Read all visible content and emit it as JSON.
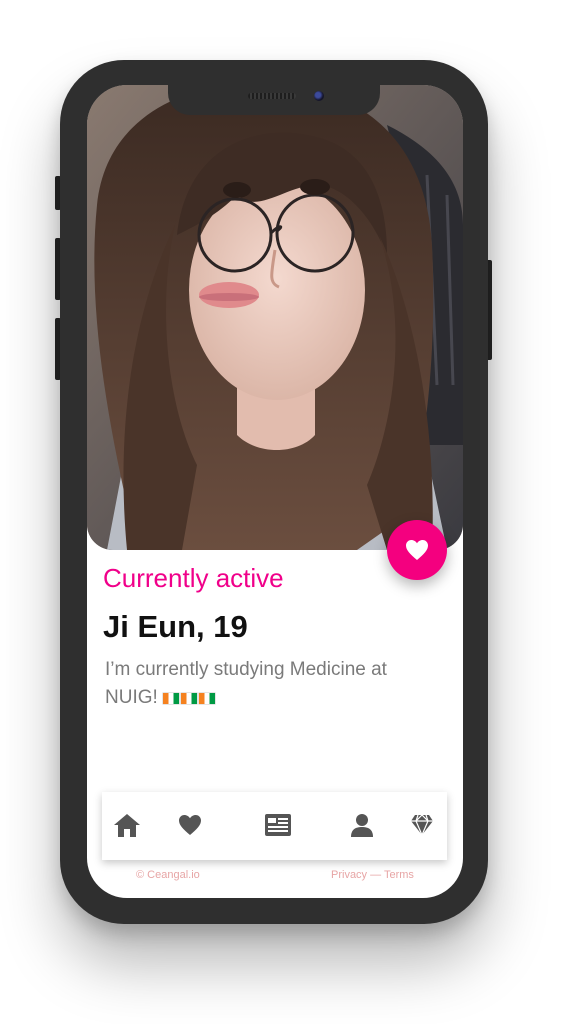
{
  "profile": {
    "status": "Currently active",
    "name_age": "Ji Eun, 19",
    "bio": "I’m currently studying Medicine at NUIG!",
    "flags": [
      {
        "icon": "ireland-flag-icon"
      },
      {
        "icon": "ireland-flag-icon"
      },
      {
        "icon": "ireland-flag-icon"
      }
    ]
  },
  "actions": {
    "like_icon": "heart-icon"
  },
  "nav": {
    "items": [
      {
        "icon": "home-icon"
      },
      {
        "icon": "heart-icon"
      },
      {
        "icon": "newspaper-icon"
      },
      {
        "icon": "user-icon"
      },
      {
        "icon": "diamond-icon"
      }
    ]
  },
  "footer": {
    "copyright": "© Ceangal.io",
    "links": "Privacy — Terms"
  },
  "colors": {
    "accent": "#f0008a",
    "phone_frame": "#2f2f2f",
    "nav_icon": "#555555",
    "footer_text": "#e7a5a5"
  }
}
